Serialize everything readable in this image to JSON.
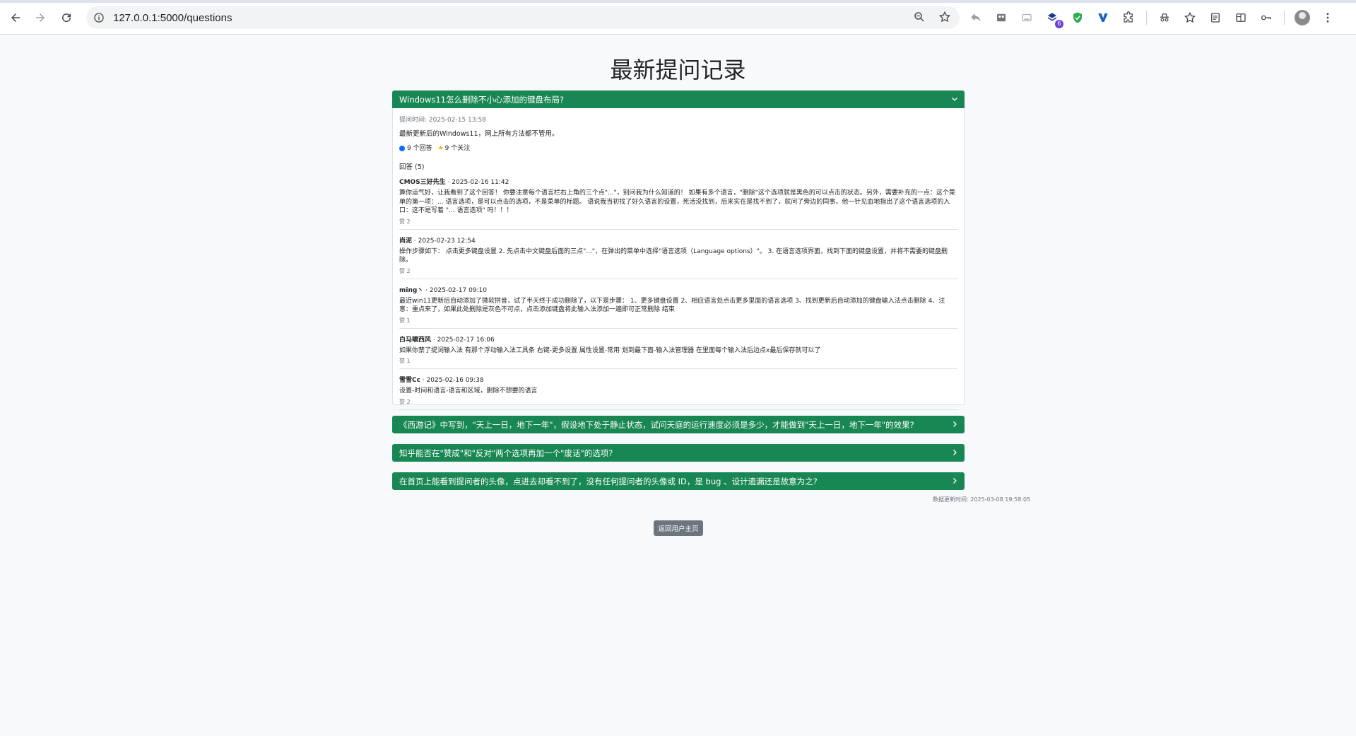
{
  "browser": {
    "url": "127.0.0.1:5000/questions",
    "extension_badge": "6"
  },
  "page": {
    "title": "最新提问记录",
    "update_time": "数据更新时间: 2025-03-08 19:58:05",
    "back_button": "返回用户主页"
  },
  "questions": [
    {
      "title": "Windows11怎么删除不小心添加的键盘布局?",
      "expanded": true,
      "time": "提问时间: 2025-02-15 13:58",
      "content": "最新更新后的Windows11，网上所有方法都不管用。",
      "answers_count": "9 个回答",
      "follows": "9 个关注",
      "answers_heading": "回答 (5)",
      "answers": [
        {
          "author": "CMOS三好先生",
          "time": " · 2025-02-16 11:42",
          "text": "算你运气好，让我看到了这个回答！ 你要注意每个语言栏右上角的三个点\"...\"，别问我为什么知道的！ 如果有多个语言，\"删除\"这个选项就是黑色的可以点击的状态。另外，需要补充的一点：这个菜单的第一项：... 语言选项，是可以点击的选项，不是菜单的标题。 语说我当初找了好久语言的设置，死活没找到，后来实在是找不到了，就问了旁边的同事，他一针见血地指出了这个语言选项的入口：这不是写着 \"... 语言选项\" 吗！！！",
          "likes": "赞 2"
        },
        {
          "author": "尚泥",
          "time": " · 2025-02-23 12:54",
          "text": "操作步骤如下： 点击更多键盘设置 2. 先点击中文键盘后面的三点\"...\"，在弹出的菜单中选择\"语言选项（Language options）\"。 3. 在语言选项界面，找到下面的键盘设置，并将不需要的键盘删除。",
          "likes": "赞 2"
        },
        {
          "author": "ming丶",
          "time": " · 2025-02-17 09:10",
          "text": "最近win11更新后自动添加了微软拼音，试了半天终于成功删除了，以下是步骤： 1、更多键盘设置 2、相应语言处点击更多里面的语言选项 3、找到更新后自动添加的键盘输入法点击删除 4、注意：重点来了，如果此处删除是灰色不可点，点击添加键盘将此输入法添加一遍即可正常删除 结束",
          "likes": "赞 1"
        },
        {
          "author": "白马啸西风",
          "time": " · 2025-02-17 16:06",
          "text": "如果你禁了提词输入法 有那个浮动输入法工具条 右键-更多设置 属性设置-常用 划到最下面-输入法管理器 在里面每个输入法后边点x最后保存就可以了",
          "likes": "赞 1"
        },
        {
          "author": "雪雪Cc",
          "time": " · 2025-02-16 09:38",
          "text": "设置-时间和语言-语言和区域，删除不想要的语言",
          "likes": "赞 2"
        }
      ]
    },
    {
      "title": "《西游记》中写到，\"天上一日，地下一年\"，假设地下处于静止状态，试问天庭的运行速度必须是多少，才能做到\"天上一日，地下一年\"的效果?",
      "expanded": false
    },
    {
      "title": "知乎能否在\"赞成\"和\"反对\"两个选项再加一个\"废话\"的选项?",
      "expanded": false
    },
    {
      "title": "在首页上能看到提问者的头像，点进去却看不到了，没有任何提问者的头像或 ID，是 bug 、设计遗漏还是故意为之?",
      "expanded": false
    }
  ]
}
